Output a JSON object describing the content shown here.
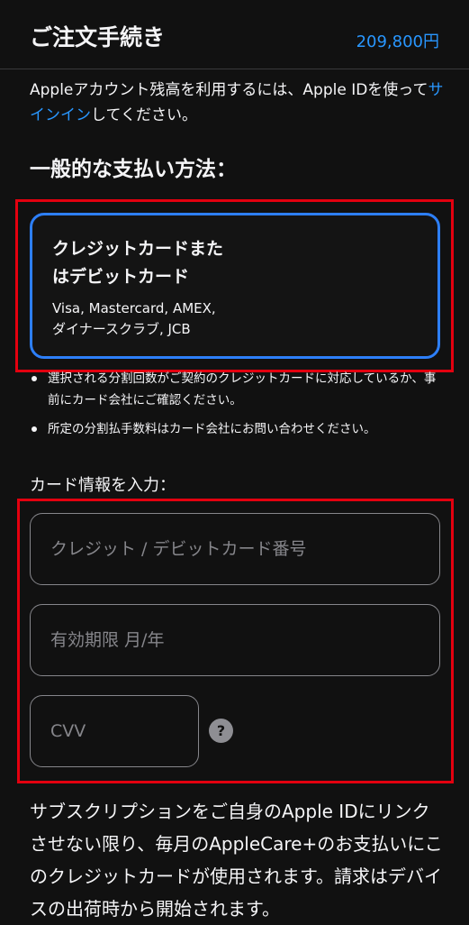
{
  "header": {
    "title": "ご注文手続き",
    "price": "209,800円"
  },
  "notice": {
    "text_before": "Appleアカウント残高を利用するには、Apple IDを使って",
    "link_text": "サインイン",
    "text_after": "してください。"
  },
  "payment_section": {
    "title": "一般的な支払い方法：",
    "card_option": {
      "title_line1": "クレジットカードまた",
      "title_line2": "はデビットカード",
      "sub_line1": "Visa, Mastercard, AMEX,",
      "sub_line2": "ダイナースクラブ, JCB"
    },
    "bullets": [
      "選択される分割回数がご契約のクレジットカードに対応しているか、事前にカード会社にご確認ください。",
      "所定の分割払手数料はカード会社にお問い合わせください。"
    ]
  },
  "card_info": {
    "label": "カード情報を入力：",
    "card_number_placeholder": "クレジット / デビットカード番号",
    "expiry_placeholder": "有効期限 月/年",
    "cvv_placeholder": "CVV",
    "help_glyph": "?"
  },
  "footer": {
    "text": "サブスクリプションをご自身のApple IDにリンクさせない限り、毎月のAppleCare+のお支払いにこのクレジットカードが使用されます。請求はデバイスの出荷時から開始されます。"
  },
  "colors": {
    "background": "#111111",
    "accent": "#2997ff",
    "selected_border": "#2d7ff9",
    "highlight": "#e3000f"
  },
  "icons": {
    "help": "question-circle-icon",
    "bullet": "bullet-dot-icon"
  }
}
